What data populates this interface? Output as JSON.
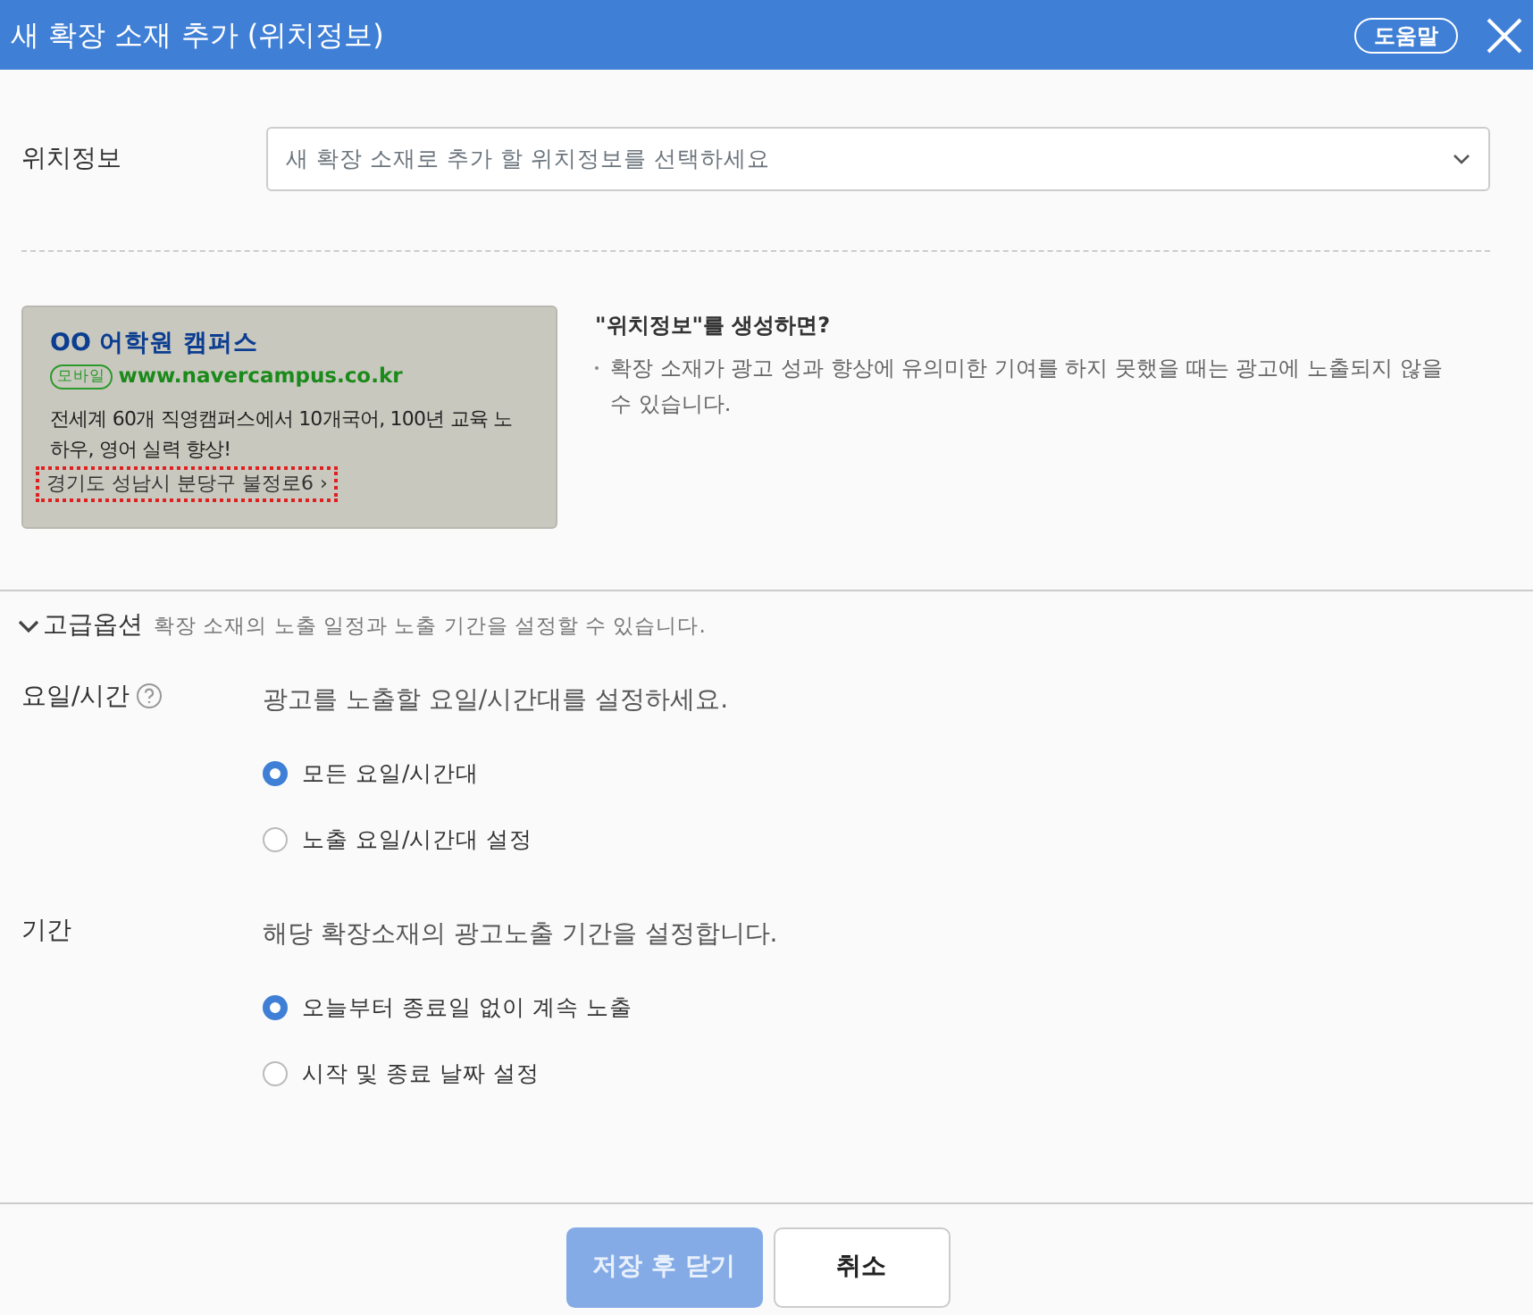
{
  "window": {
    "title": "새 확장 소재 추가 (위치정보)",
    "help_button": "도움말"
  },
  "location": {
    "label": "위치정보",
    "placeholder": "새 확장 소재로 추가 할 위치정보를 선택하세요"
  },
  "preview": {
    "title": "OO 어학원 캠퍼스",
    "badge": "모바일",
    "url": "www.navercampus.co.kr",
    "description": "전세계 60개 직영캠퍼스에서 10개국어, 100년 교육 노하우, 영어 실력 향상!",
    "address": "경기도 성남시 분당구 불정로6 ›"
  },
  "info": {
    "title": "\"위치정보\"를 생성하면?",
    "items": [
      "확장 소재가 광고 성과 향상에 유의미한 기여를 하지 못했을 때는 광고에 노출되지 않을 수 있습니다."
    ]
  },
  "advanced": {
    "label": "고급옵션",
    "expanded": true,
    "description": "확장 소재의 노출 일정과 노출 기간을 설정할 수 있습니다."
  },
  "sections": [
    {
      "label": "요일/시간",
      "help": true,
      "description": "광고를 노출할 요일/시간대를 설정하세요.",
      "options": [
        {
          "label": "모든 요일/시간대",
          "selected": true
        },
        {
          "label": "노출 요일/시간대 설정",
          "selected": false
        }
      ]
    },
    {
      "label": "기간",
      "help": false,
      "description": "해당 확장소재의 광고노출 기간을 설정합니다.",
      "options": [
        {
          "label": "오늘부터 종료일 없이 계속 노출",
          "selected": true
        },
        {
          "label": "시작 및 종료 날짜 설정",
          "selected": false
        }
      ]
    }
  ],
  "buttons": [
    {
      "label": "저장 후 닫기",
      "kind": "primary",
      "disabled": true
    },
    {
      "label": "취소",
      "kind": "secondary",
      "disabled": false
    }
  ]
}
